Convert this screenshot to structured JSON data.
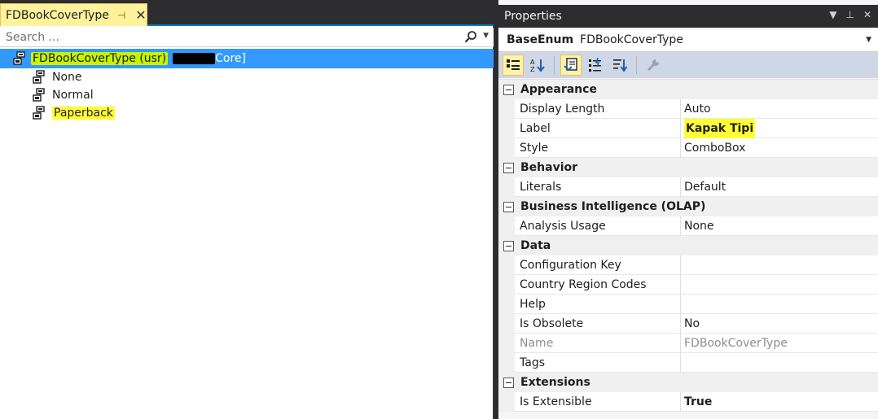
{
  "document_tab": {
    "title": "FDBookCoverType",
    "pin_glyph": "⊣",
    "close_glyph": "✕"
  },
  "search": {
    "placeholder": "Search ..."
  },
  "tree": {
    "root": {
      "name": "FDBookCoverType (usr)",
      "suffix": "Core]"
    },
    "children": [
      {
        "label": "None"
      },
      {
        "label": "Normal"
      },
      {
        "label": "Paperback"
      }
    ]
  },
  "properties_panel": {
    "title": "Properties",
    "object_type": "BaseEnum",
    "object_name": "FDBookCoverType",
    "categories": [
      {
        "name": "Appearance",
        "rows": [
          {
            "name": "Display Length",
            "value": "Auto"
          },
          {
            "name": "Label",
            "value": "Kapak Tipi"
          },
          {
            "name": "Style",
            "value": "ComboBox"
          }
        ]
      },
      {
        "name": "Behavior",
        "rows": [
          {
            "name": "Literals",
            "value": "Default"
          }
        ]
      },
      {
        "name": "Business Intelligence (OLAP)",
        "rows": [
          {
            "name": "Analysis Usage",
            "value": "None"
          }
        ]
      },
      {
        "name": "Data",
        "rows": [
          {
            "name": "Configuration Key",
            "value": ""
          },
          {
            "name": "Country Region Codes",
            "value": ""
          },
          {
            "name": "Help",
            "value": ""
          },
          {
            "name": "Is Obsolete",
            "value": "No"
          },
          {
            "name": "Name",
            "value": "FDBookCoverType"
          },
          {
            "name": "Tags",
            "value": ""
          }
        ]
      },
      {
        "name": "Extensions",
        "rows": [
          {
            "name": "Is Extensible",
            "value": "True"
          }
        ]
      }
    ]
  },
  "colors": {
    "accent_blue": "#007acc",
    "selection_blue": "#3399ff",
    "tab_yellow": "#fff29d",
    "highlight_yellow": "#ffff33",
    "highlight_green": "#c6f400",
    "toolbar_bg": "#cfd6e5"
  },
  "icons": {
    "enum_node": "enum-element-icon",
    "search": "magnifier-icon",
    "toolbar": [
      "categorized-icon",
      "alphabetical-icon",
      "properties-icon",
      "events-icon",
      "sort-icon",
      "wrench-icon"
    ]
  }
}
